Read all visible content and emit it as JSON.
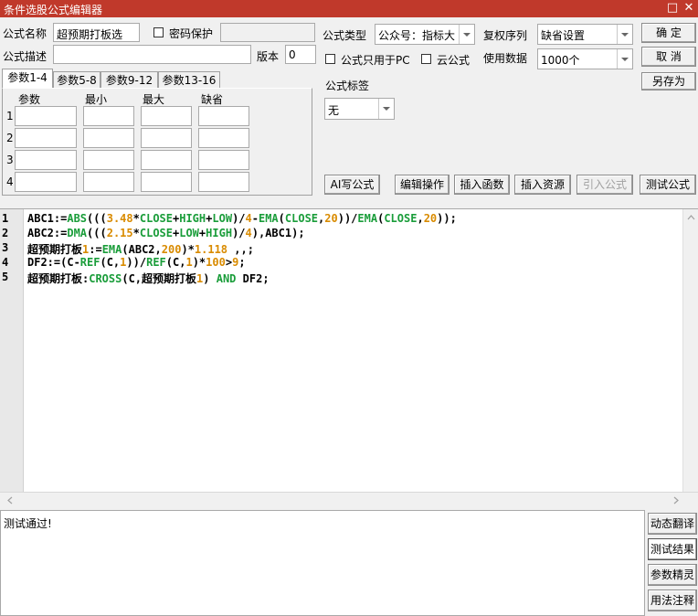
{
  "window": {
    "title": "条件选股公式编辑器",
    "maximize_icon": "□",
    "close_icon": "✕"
  },
  "form": {
    "name_label": "公式名称",
    "name_value": "超预期打板选",
    "password_label": "密码保护",
    "password_value": "",
    "desc_label": "公式描述",
    "desc_value": "",
    "version_label": "版本",
    "version_value": "0",
    "type_label": "公式类型",
    "type_value": "公众号：指标大",
    "pc_only_label": "公式只用于PC",
    "cloud_label": "云公式",
    "rights_label": "复权序列",
    "rights_value": "缺省设置",
    "data_label": "使用数据",
    "data_value": "1000个",
    "tag_label": "公式标签",
    "tag_value": "无"
  },
  "buttons": {
    "ok": "确  定",
    "cancel": "取  消",
    "save_as": "另存为",
    "ai_write": "AI写公式",
    "edit_ops": "编辑操作",
    "insert_func": "插入函数",
    "insert_res": "插入资源",
    "import_formula": "引入公式",
    "test_formula": "测试公式"
  },
  "params": {
    "tabs": [
      "参数1-4",
      "参数5-8",
      "参数9-12",
      "参数13-16"
    ],
    "headers": [
      "参数",
      "最小",
      "最大",
      "缺省"
    ],
    "rows": [
      "1",
      "2",
      "3",
      "4"
    ]
  },
  "code_lines": [
    {
      "num": "1",
      "text": "ABC1:=ABS(((3.48*CLOSE+HIGH+LOW)/4-EMA(CLOSE,20))/EMA(CLOSE,20));"
    },
    {
      "num": "2",
      "text": "ABC2:=DMA(((2.15*CLOSE+LOW+HIGH)/4),ABC1);"
    },
    {
      "num": "3",
      "text": "超预期打板1:=EMA(ABC2,200)*1.118 ,,;"
    },
    {
      "num": "4",
      "text": "DF2:=(C-REF(C,1))/REF(C,1)*100>9;"
    },
    {
      "num": "5",
      "text": "超预期打板:CROSS(C,超预期打板1) AND DF2;"
    }
  ],
  "output": {
    "text": "测试通过!"
  },
  "side_buttons": [
    "动态翻译",
    "测试结果",
    "参数精灵",
    "用法注释"
  ],
  "colors": {
    "title_bg": "#c0392b",
    "func": "#1a9d3a",
    "number": "#d98b00"
  }
}
